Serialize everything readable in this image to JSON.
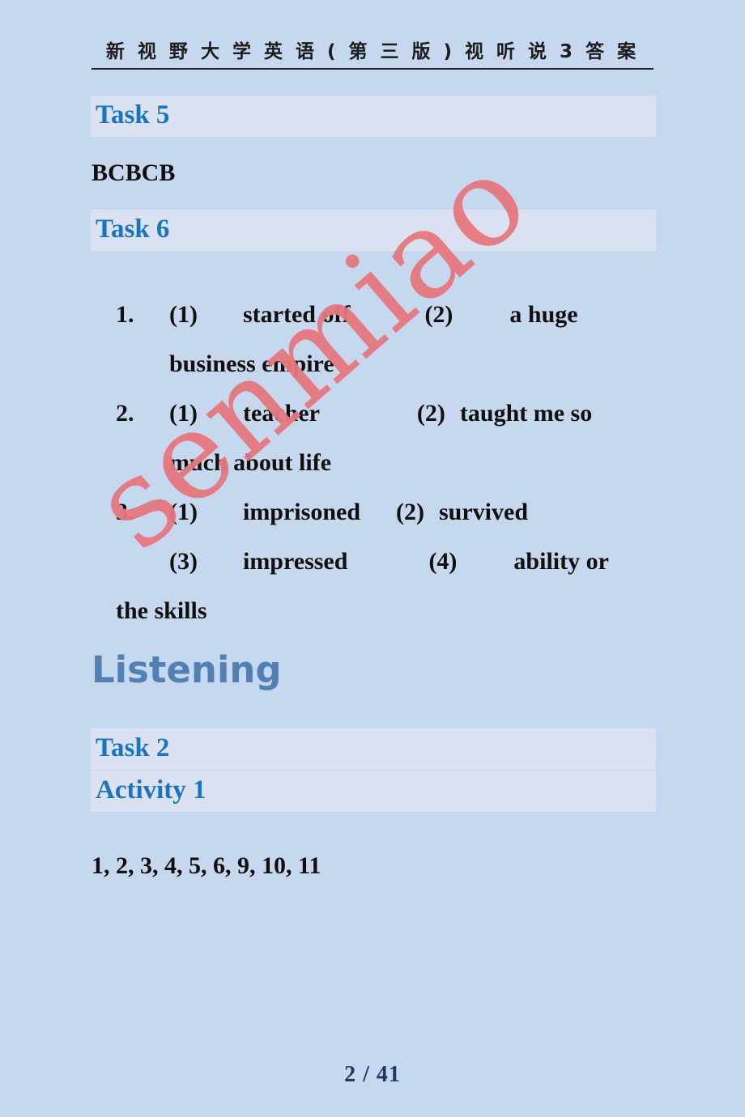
{
  "page": {
    "background_color": "#c6d7f0",
    "banner_color": "#dae2f1",
    "accent_blue": "#1a74bf",
    "section_blue": "#5180b4",
    "watermark_color": "#e6787e",
    "footer": "2 / 41"
  },
  "header": {
    "title": "新 视 野 大 学 英 语 ( 第 三 版 ) 视 听 说  3  答 案"
  },
  "watermark": {
    "text": "senmiao"
  },
  "sections": [
    {
      "banner": "Task 5",
      "answer": "BCBCB"
    },
    {
      "banner": "Task 6",
      "items": [
        {
          "number": "1.",
          "parts": [
            {
              "label": "(1)",
              "value": "started off"
            },
            {
              "label": "(2)",
              "value": "a huge"
            }
          ],
          "continuation": "business empire"
        },
        {
          "number": "2.",
          "parts": [
            {
              "label": "(1)",
              "value": "teacher"
            },
            {
              "label": "(2)",
              "value": "taught me so"
            }
          ],
          "continuation": "much about life"
        },
        {
          "number": "3.",
          "parts": [
            {
              "label": "(1)",
              "value": "imprisoned"
            },
            {
              "label": "(2)",
              "value": "survived"
            },
            {
              "label": "(3)",
              "value": "impressed"
            },
            {
              "label": "(4)",
              "value": "ability or"
            }
          ],
          "continuation": "the skills"
        }
      ]
    }
  ],
  "listening": {
    "title": "Listening",
    "banners": [
      "Task 2",
      "Activity 1"
    ],
    "answer": "1, 2, 3, 4, 5, 6, 9, 10, 11"
  }
}
